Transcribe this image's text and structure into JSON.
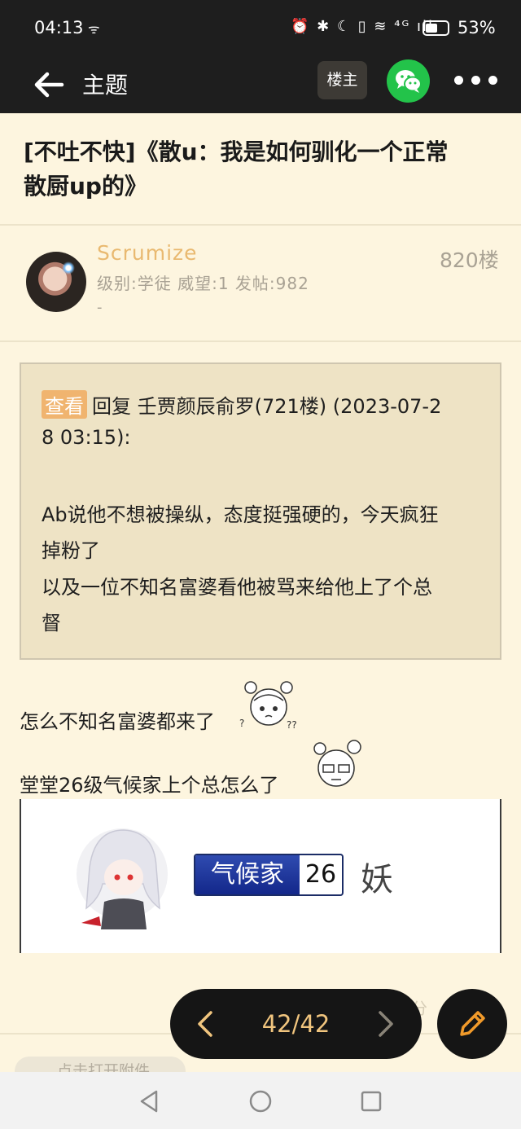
{
  "status_bar": {
    "time": "04:13",
    "system_icons": "⏰ ✱ ☾ ▯ ≋ ⁴ᴳ ıll",
    "battery_percent": "53%",
    "battery_level": 0.53
  },
  "header": {
    "title": "主题",
    "owner_button": "楼主"
  },
  "thread": {
    "title_line1": "[不吐不快]《散u：我是如何驯化一个正常",
    "title_line2": "散厨up的》"
  },
  "post": {
    "username": "Scrumize",
    "user_info": "级别:学徒 威望:1 发帖:982",
    "signature": "-",
    "floor": "820楼",
    "quote": {
      "view_tag": "查看",
      "line1": "回复 壬贾颜辰俞罗(721楼) (2023-07-2",
      "line2": "8 03:15):",
      "line3": "Ab说他不想被操纵，态度挺强硬的，今天疯狂",
      "line4": "掉粉了",
      "line5": "以及一位不知名富婆看他被骂来给他上了个总",
      "line6": "督"
    },
    "body_line1": "怎么不知名富婆都来了",
    "body_line2": "堂堂26级气候家上个总怎么了",
    "image": {
      "rank_name": "气候家",
      "rank_level": "26",
      "suffix": "妖"
    }
  },
  "footer": {
    "faded_share": "分",
    "attachment": "点击打开附件"
  },
  "pager": {
    "page_text": "42/42"
  },
  "colors": {
    "background": "#fdf5df",
    "bar": "#1e1e1e",
    "accent": "#f1c57e",
    "wechat": "#23c34a",
    "username": "#e9b970"
  }
}
